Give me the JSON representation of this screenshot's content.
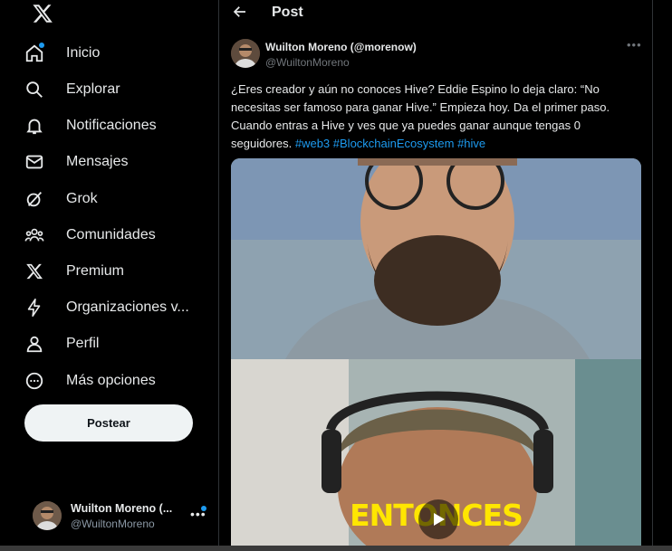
{
  "sidebar": {
    "items": [
      {
        "label": "Inicio",
        "icon": "home-icon",
        "has_dot": true
      },
      {
        "label": "Explorar",
        "icon": "search-icon"
      },
      {
        "label": "Notificaciones",
        "icon": "bell-icon"
      },
      {
        "label": "Mensajes",
        "icon": "envelope-icon"
      },
      {
        "label": "Grok",
        "icon": "grok-icon"
      },
      {
        "label": "Comunidades",
        "icon": "people-icon"
      },
      {
        "label": "Premium",
        "icon": "x-logo-icon"
      },
      {
        "label": "Organizaciones v...",
        "icon": "lightning-icon"
      },
      {
        "label": "Perfil",
        "icon": "person-icon"
      },
      {
        "label": "Más opciones",
        "icon": "more-circle-icon"
      }
    ],
    "post_button": "Postear",
    "account": {
      "name": "Wuilton Moreno (...",
      "handle": "@WuiltonMoreno"
    }
  },
  "main": {
    "title": "Post",
    "author": {
      "name": "Wuilton Moreno (@morenow)",
      "handle": "@WuiltonMoreno"
    },
    "text": "¿Eres creador y aún no conoces Hive?   Eddie Espino lo deja claro: “No necesitas ser famoso para ganar Hive.”   Empieza hoy. Da el primer paso. Cuando entras a Hive y ves que ya puedes ganar aunque tengas 0 seguidores.",
    "hashtags": [
      "#web3",
      "#BlockchainEcosystem",
      "#hive"
    ],
    "video_caption": "ENTONCES"
  },
  "colors": {
    "accent": "#1d9bf0",
    "caption": "#ffe600",
    "background": "#000000"
  }
}
